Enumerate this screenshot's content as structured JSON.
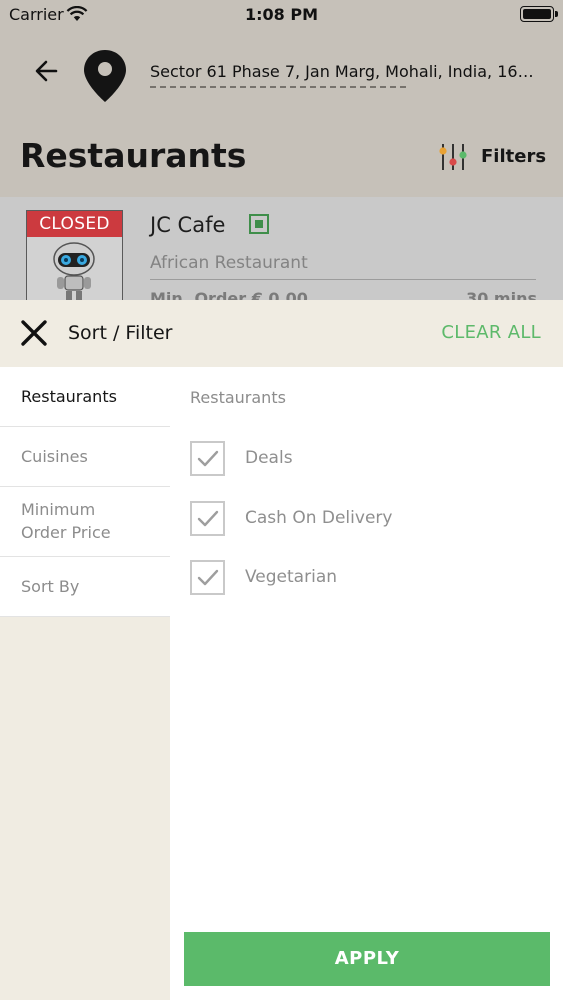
{
  "status_bar": {
    "carrier": "Carrier",
    "time": "1:08 PM"
  },
  "header": {
    "address": "Sector 61 Phase 7, Jan Marg, Mohali, India, 1600...",
    "title": "Restaurants",
    "filters_label": "Filters"
  },
  "restaurant_card": {
    "badge": "CLOSED",
    "name": "JC Cafe",
    "cuisine": "African Restaurant",
    "min_order": "Min. Order € 0.00",
    "delivery_time": "30 mins"
  },
  "sort_filter": {
    "title": "Sort / Filter",
    "clear_all": "CLEAR ALL",
    "tabs": [
      {
        "label": "Restaurants",
        "active": true
      },
      {
        "label": "Cuisines",
        "active": false
      },
      {
        "label": "Minimum Order Price",
        "active": false
      },
      {
        "label": "Sort By",
        "active": false
      }
    ],
    "section_heading": "Restaurants",
    "options": [
      {
        "label": "Deals",
        "checked": true
      },
      {
        "label": "Cash On Delivery",
        "checked": true
      },
      {
        "label": "Vegetarian",
        "checked": true
      }
    ],
    "apply_label": "APPLY"
  },
  "colors": {
    "accent_green": "#5bba6a",
    "closed_red": "#cc3a3f",
    "sheet_beige": "#f0ece2",
    "veg_green": "#3f8e4a"
  }
}
